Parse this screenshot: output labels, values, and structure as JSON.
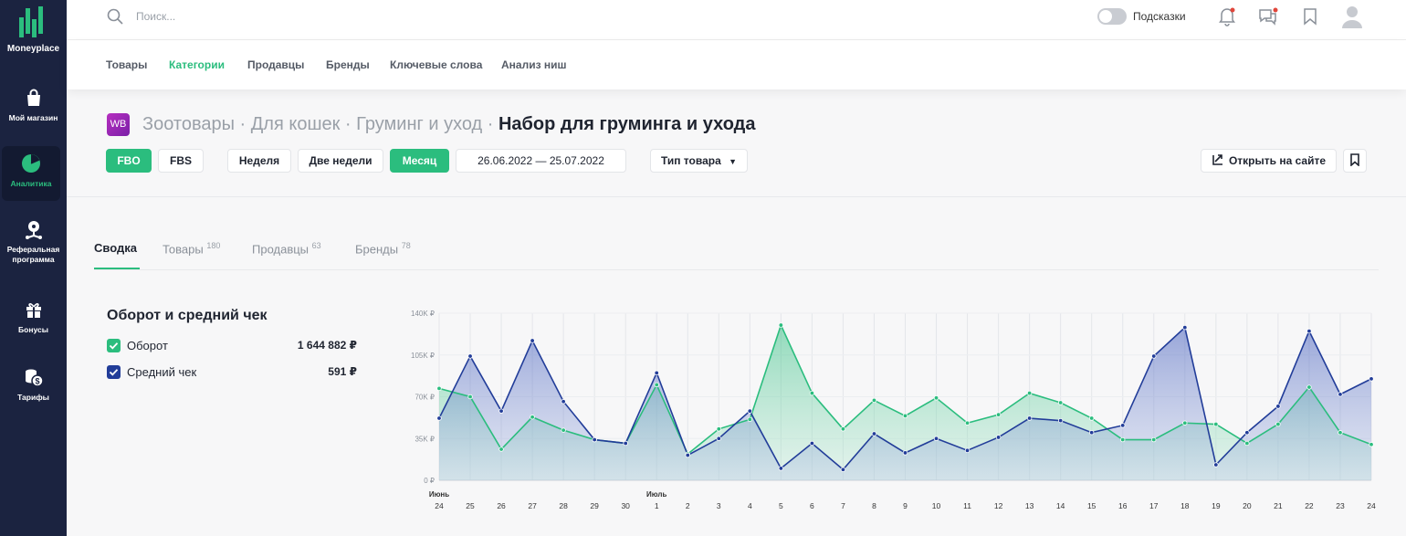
{
  "app": {
    "brand": "Moneyplace"
  },
  "sidebar": {
    "items": [
      {
        "label": "Мой магазин",
        "icon": "bag-icon"
      },
      {
        "label": "Аналитика",
        "icon": "pie-chart-icon"
      },
      {
        "label_line1": "Реферальная",
        "label_line2": "программа",
        "icon": "referral-icon"
      },
      {
        "label": "Бонусы",
        "icon": "gift-icon"
      },
      {
        "label": "Тарифы",
        "icon": "coins-icon"
      }
    ]
  },
  "header": {
    "search_placeholder": "Поиск...",
    "hints_label": "Подсказки",
    "hints_enabled": false
  },
  "nav": {
    "items": [
      "Товары",
      "Категории",
      "Продавцы",
      "Бренды",
      "Ключевые слова",
      "Анализ ниш"
    ],
    "active": "Категории"
  },
  "page": {
    "marketplace_badge": "WB",
    "breadcrumbs": [
      "Зоотовары · ",
      "Для кошек · ",
      "Груминг и уход · "
    ],
    "current": "Набор для груминга и ухода"
  },
  "filters": {
    "fbo": "FBO",
    "fbs": "FBS",
    "week": "Неделя",
    "two_weeks": "Две недели",
    "month": "Месяц",
    "date_range": "26.06.2022 — 25.07.2022",
    "product_type": "Тип товара",
    "open_on_site": "Открыть на сайте"
  },
  "tabs": [
    {
      "label": "Сводка",
      "count": ""
    },
    {
      "label": "Товары",
      "count": "180"
    },
    {
      "label": "Продавцы",
      "count": "63"
    },
    {
      "label": "Бренды",
      "count": "78"
    }
  ],
  "legend": {
    "title": "Оборот и средний чек",
    "items": [
      {
        "name": "Оборот",
        "value": "1 644 882 ₽",
        "color": "#2bbd7e"
      },
      {
        "name": "Средний чек",
        "value": "591 ₽",
        "color": "#223d99"
      }
    ]
  },
  "chart_data": {
    "type": "area",
    "y_ticks": [
      "0 ₽",
      "35K ₽",
      "70K ₽",
      "105K ₽",
      "140K ₽"
    ],
    "ylim": [
      0,
      140000
    ],
    "x": [
      "24",
      "25",
      "26",
      "27",
      "28",
      "29",
      "30",
      "1",
      "2",
      "3",
      "4",
      "5",
      "6",
      "7",
      "8",
      "9",
      "10",
      "11",
      "12",
      "13",
      "14",
      "15",
      "16",
      "17",
      "18",
      "19",
      "20",
      "21",
      "22",
      "23",
      "24"
    ],
    "month_labels": [
      {
        "index": 0,
        "text": "Июнь"
      },
      {
        "index": 7,
        "text": "Июль"
      }
    ],
    "grid": true,
    "series": [
      {
        "name": "Оборот",
        "color": "#2bbd7e",
        "values": [
          77000,
          70000,
          26000,
          53000,
          42000,
          34000,
          31000,
          80000,
          22000,
          43000,
          51000,
          130000,
          73000,
          43000,
          67000,
          54000,
          69000,
          48000,
          55000,
          73000,
          65000,
          52000,
          34000,
          34000,
          48000,
          47000,
          31000,
          47000,
          78000,
          40000,
          30000
        ]
      },
      {
        "name": "Средний чек",
        "color": "#223d99",
        "values": [
          52000,
          104000,
          58000,
          117000,
          66000,
          34000,
          31000,
          90000,
          21000,
          35000,
          58000,
          10000,
          31000,
          9000,
          39000,
          23000,
          35000,
          25000,
          36000,
          52000,
          50000,
          40000,
          46000,
          104000,
          128000,
          13000,
          40000,
          62000,
          125000,
          72000,
          85000
        ]
      }
    ]
  }
}
